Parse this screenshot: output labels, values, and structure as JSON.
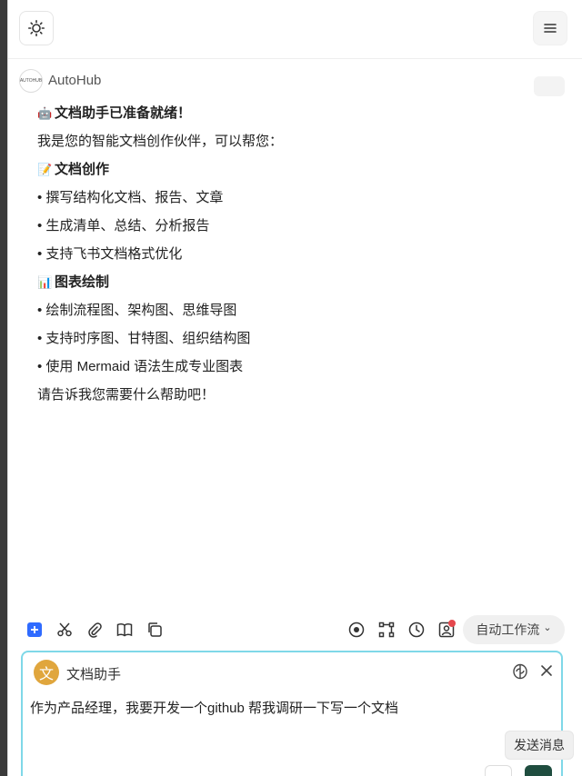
{
  "message": {
    "sender": "AutoHub",
    "avatar_text": "AUTOHUB",
    "lines": [
      {
        "emoji": "🤖",
        "text": "文档助手已准备就绪！",
        "bold": true
      },
      {
        "emoji": "",
        "text": "我是您的智能文档创作伙伴，可以帮您：",
        "bold": false
      },
      {
        "emoji": "📝",
        "text": "文档创作",
        "bold": true
      },
      {
        "emoji": "",
        "text": "• 撰写结构化文档、报告、文章",
        "bold": false
      },
      {
        "emoji": "",
        "text": "• 生成清单、总结、分析报告",
        "bold": false
      },
      {
        "emoji": "",
        "text": "• 支持飞书文档格式优化",
        "bold": false
      },
      {
        "emoji": "📊",
        "text": "图表绘制",
        "bold": true
      },
      {
        "emoji": "",
        "text": "• 绘制流程图、架构图、思维导图",
        "bold": false
      },
      {
        "emoji": "",
        "text": "• 支持时序图、甘特图、组织结构图",
        "bold": false
      },
      {
        "emoji": "",
        "text": "• 使用 Mermaid 语法生成专业图表",
        "bold": false
      },
      {
        "emoji": "",
        "text": "请告诉我您需要什么帮助吧！",
        "bold": false
      }
    ]
  },
  "toolbar": {
    "icons_left": [
      "add-note-icon",
      "scissors-icon",
      "paperclip-icon",
      "book-icon",
      "copy-icon"
    ],
    "icons_right": [
      "record-icon",
      "workflow-nodes-icon",
      "clock-icon",
      "contact-icon"
    ],
    "workflow_label": "自动工作流",
    "workflow_chevron": "⌄"
  },
  "composer": {
    "agent_avatar": "文",
    "agent_name": "文档助手",
    "input_value": "作为产品经理，我要开发一个github 帮我调研一下写一个文档",
    "send_label": "发送消息"
  },
  "colors": {
    "accent_blue": "#2f6bff",
    "input_border": "#7fd8e8",
    "agent_avatar": "#e0a63d",
    "notification": "#e5484d"
  }
}
